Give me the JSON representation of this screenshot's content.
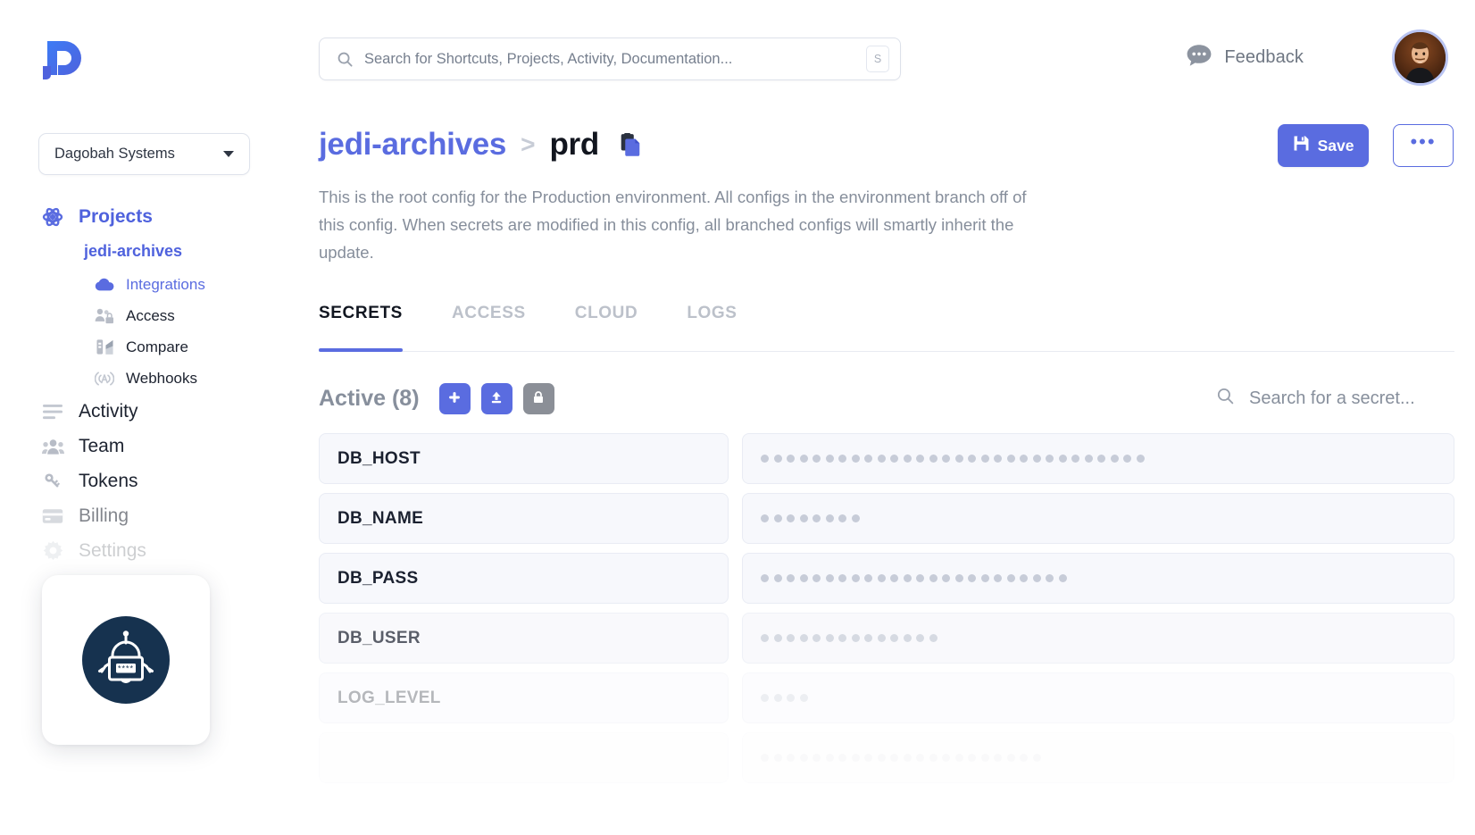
{
  "header": {
    "logo_icon": "doppler-logo-icon",
    "search": {
      "placeholder": "Search for Shortcuts, Projects, Activity, Documentation...",
      "value": "",
      "icon": "search-icon",
      "shortcut_key": "S"
    },
    "feedback": {
      "label": "Feedback",
      "icon": "chat-bubble-icon"
    },
    "avatar": {
      "name": "user-avatar"
    }
  },
  "sidebar": {
    "org_selector": {
      "value": "Dagobah Systems",
      "icon": "chevron-down-icon"
    },
    "items": [
      {
        "label": "Projects",
        "icon": "atom-icon",
        "level": 0,
        "accent": true,
        "dim": 0
      },
      {
        "label": "jedi-archives",
        "icon": "",
        "level": 1,
        "accent": true,
        "dim": 0
      },
      {
        "label": "Integrations",
        "icon": "cloud-icon",
        "level": 2,
        "accent": true,
        "dim": 0
      },
      {
        "label": "Access",
        "icon": "users-lock-icon",
        "level": 2,
        "accent": false,
        "dim": 0
      },
      {
        "label": "Compare",
        "icon": "compare-icon",
        "level": 2,
        "accent": false,
        "dim": 0
      },
      {
        "label": "Webhooks",
        "icon": "broadcast-icon",
        "level": 2,
        "accent": false,
        "dim": 0
      },
      {
        "label": "Activity",
        "icon": "list-icon",
        "level": 0,
        "accent": false,
        "dim": 0
      },
      {
        "label": "Team",
        "icon": "team-icon",
        "level": 0,
        "accent": false,
        "dim": 0
      },
      {
        "label": "Tokens",
        "icon": "key-icon",
        "level": 0,
        "accent": false,
        "dim": 0
      },
      {
        "label": "Billing",
        "icon": "credit-card-icon",
        "level": 0,
        "accent": false,
        "dim": 1
      },
      {
        "label": "Settings",
        "icon": "gear-icon",
        "level": 0,
        "accent": false,
        "dim": 2
      }
    ],
    "robot_widget": {
      "icon": "robot-lock-icon",
      "mask": "****"
    }
  },
  "main": {
    "breadcrumb": {
      "project": "jedi-archives",
      "separator": ">",
      "config": "prd",
      "copy_icon": "copy-icon"
    },
    "actions": {
      "save_label": "Save",
      "save_icon": "floppy-disk-icon",
      "more_label": "•••"
    },
    "description": "This is the root config for the Production environment. All configs in the environment branch off of this config. When secrets are modified in this config, all branched configs will smartly inherit the update.",
    "tabs": [
      {
        "label": "SECRETS",
        "active": true
      },
      {
        "label": "ACCESS",
        "active": false
      },
      {
        "label": "CLOUD",
        "active": false
      },
      {
        "label": "LOGS",
        "active": false
      }
    ],
    "secrets_header": {
      "title": "Active (8)",
      "buttons": [
        {
          "name": "add-secret-button",
          "icon": "plus-icon",
          "color": "#5a6ce0"
        },
        {
          "name": "import-secret-button",
          "icon": "upload-icon",
          "color": "#5a6ce0"
        },
        {
          "name": "lock-secret-button",
          "icon": "lock-icon",
          "color": "#8b8f97"
        }
      ],
      "search": {
        "placeholder": "Search for a secret...",
        "value": "",
        "icon": "search-icon"
      }
    },
    "secrets": [
      {
        "key": "DB_HOST",
        "masked_length": 30,
        "opacity": 1.0
      },
      {
        "key": "DB_NAME",
        "masked_length": 8,
        "opacity": 1.0
      },
      {
        "key": "DB_PASS",
        "masked_length": 24,
        "opacity": 1.0
      },
      {
        "key": "DB_USER",
        "masked_length": 14,
        "opacity": 0.72
      },
      {
        "key": "LOG_LEVEL",
        "masked_length": 4,
        "opacity": 0.32
      },
      {
        "key": "",
        "masked_length": 22,
        "opacity": 0.1
      }
    ]
  },
  "colors": {
    "accent": "#5a6ce0",
    "accent_light": "#b9c4f2",
    "text": "#1b2130",
    "muted": "#878f9c",
    "cell_bg": "#f7f8fc",
    "robot_bg": "#16324f"
  }
}
